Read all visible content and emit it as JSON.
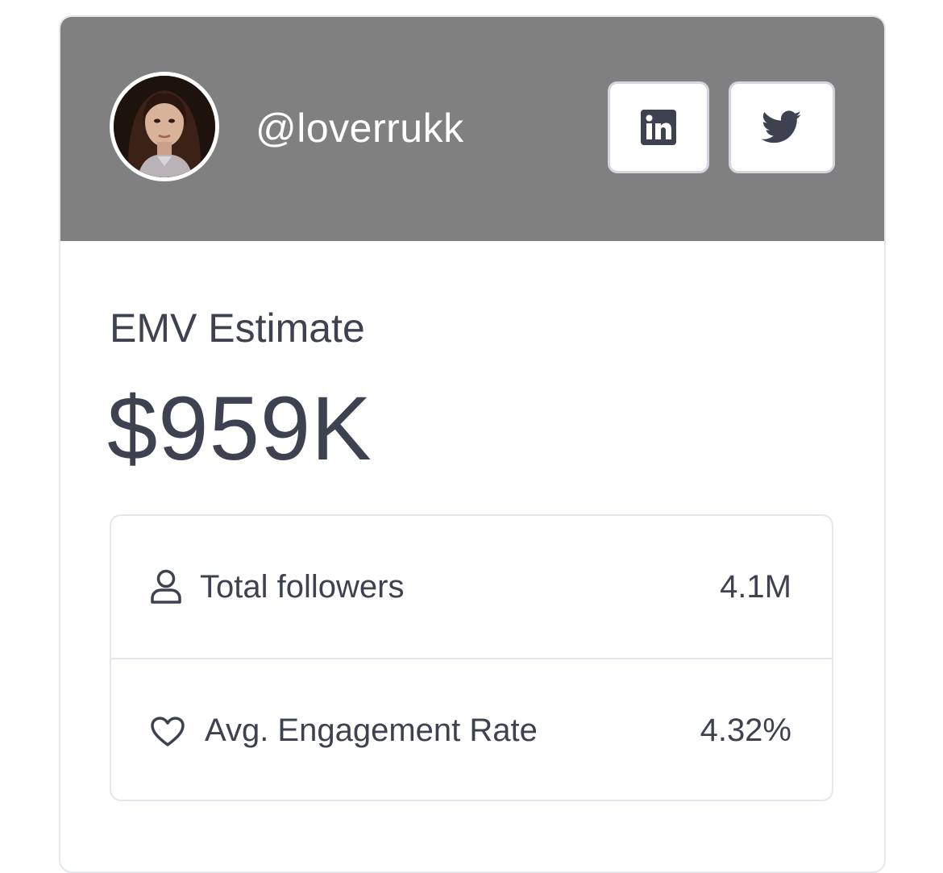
{
  "profile": {
    "handle": "@loverrukk",
    "avatar_icon": "profile-photo",
    "header_color": "#808080"
  },
  "social": {
    "linkedin_icon": "linkedin-icon",
    "twitter_icon": "twitter-icon"
  },
  "emv": {
    "label": "EMV Estimate",
    "value": "$959K"
  },
  "stats": [
    {
      "icon": "user-icon",
      "label": "Total followers",
      "value": "4.1M"
    },
    {
      "icon": "heart-icon",
      "label": "Avg. Engagement Rate",
      "value": "4.32%"
    }
  ],
  "colors": {
    "text": "#3d4150",
    "border": "#e4e7ee",
    "header_bg": "#808080"
  }
}
